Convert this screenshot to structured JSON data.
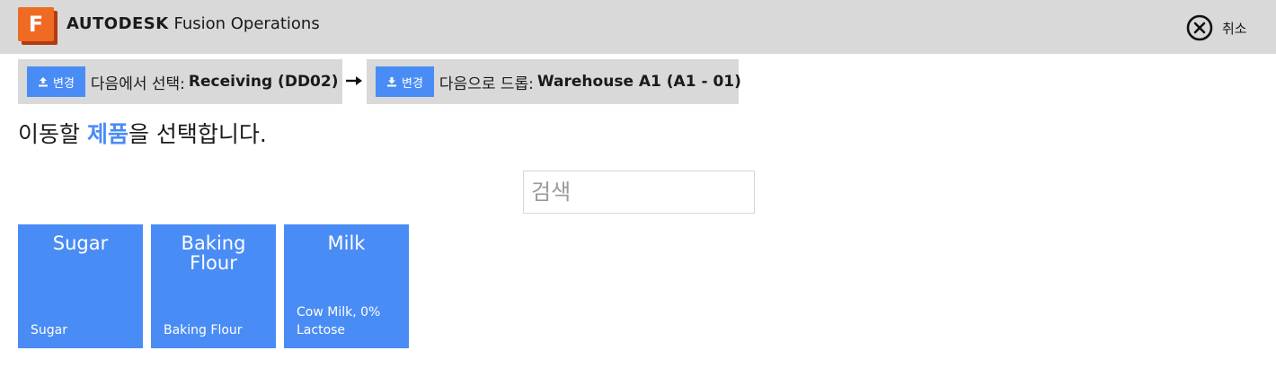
{
  "header": {
    "brand_bold": "AUTODESK",
    "brand_rest": " Fusion Operations",
    "logo_letter": "F",
    "logo_icon": "fusion-operations-logo",
    "cancel_label": "취소",
    "cancel_icon": "close-circle-icon"
  },
  "source": {
    "change_label": "변경",
    "change_icon": "upload-icon",
    "label": "다음에서 선택:",
    "value": "Receiving (DD02)"
  },
  "arrow_icon": "arrow-right-icon",
  "destination": {
    "change_label": "변경",
    "change_icon": "download-icon",
    "label": "다음으로 드롭:",
    "value": "Warehouse A1 (A1 - 01)"
  },
  "heading": {
    "before": "이동할 ",
    "highlight": "제품",
    "after": "을 선택합니다."
  },
  "search": {
    "placeholder": "검색",
    "value": ""
  },
  "products": [
    {
      "title": "Sugar",
      "subtitle": "Sugar"
    },
    {
      "title": "Baking Flour",
      "subtitle": "Baking Flour"
    },
    {
      "title": "Milk",
      "subtitle": "Cow Milk, 0% Lactose"
    }
  ],
  "colors": {
    "accent": "#4a8cf5",
    "topbar": "#d9d9d9",
    "logo": "#ef6a23"
  }
}
